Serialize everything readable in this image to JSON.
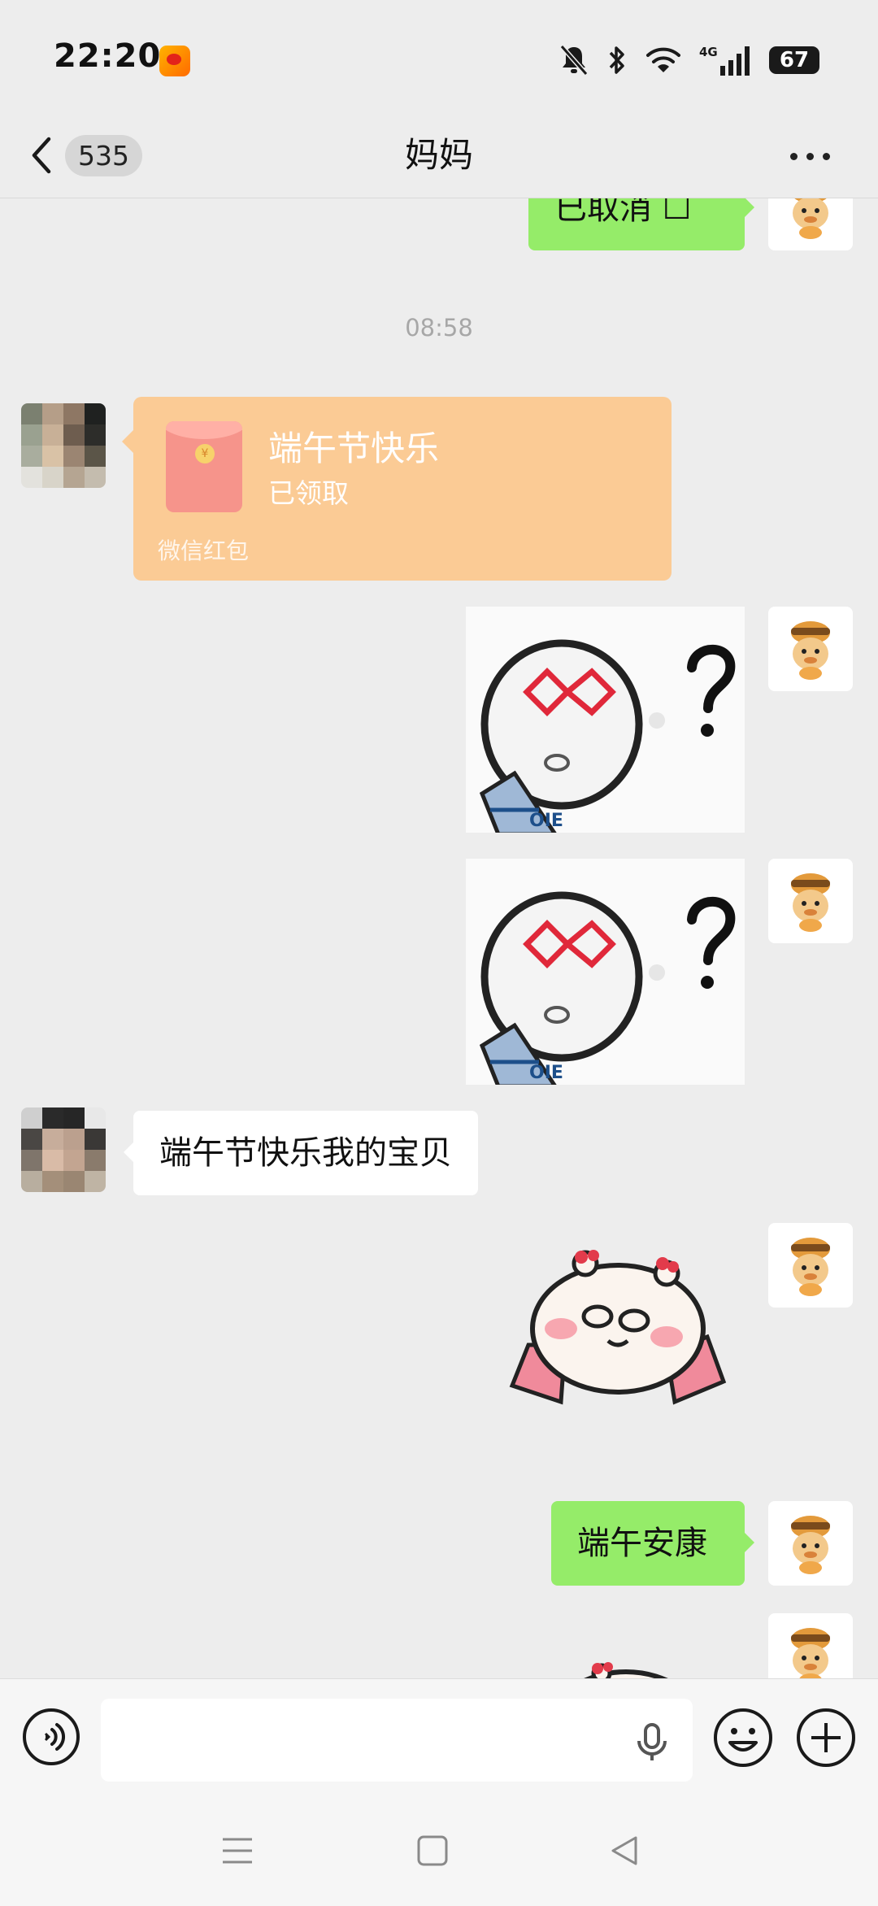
{
  "status_bar": {
    "time": "22:20",
    "app_notification_icon": "weibo-icon",
    "icons": [
      "mute-icon",
      "bluetooth-icon",
      "wifi-icon",
      "signal-4g-icon"
    ],
    "network_label": "4G",
    "battery": "67"
  },
  "header": {
    "unread_count": "535",
    "title": "妈妈",
    "back_icon": "chevron-left-icon",
    "more_icon": "more-icon"
  },
  "messages": [
    {
      "sender": "self",
      "type": "text",
      "text": "已取消 ☐"
    },
    {
      "type": "timestamp",
      "text": "08:58"
    },
    {
      "sender": "mom",
      "type": "red_packet",
      "title": "端午节快乐",
      "status": "已领取",
      "footer": "微信红包"
    },
    {
      "sender": "self",
      "type": "sticker",
      "sticker": "confused-face-sticker"
    },
    {
      "sender": "self",
      "type": "sticker",
      "sticker": "confused-face-sticker"
    },
    {
      "sender": "mom",
      "type": "text",
      "text": "端午节快乐我的宝贝"
    },
    {
      "sender": "self",
      "type": "sticker",
      "sticker": "shopping-bear-sticker"
    },
    {
      "sender": "self",
      "type": "text",
      "text": "端午安康"
    },
    {
      "sender": "self",
      "type": "sticker",
      "sticker": "shopping-bear-sticker"
    }
  ],
  "input_bar": {
    "text_value": "",
    "icons": [
      "voice-icon",
      "microphone-icon",
      "emoji-icon",
      "plus-icon"
    ]
  },
  "colors": {
    "background": "#ededed",
    "self_bubble": "#95ec69",
    "other_bubble": "#ffffff",
    "red_packet": "#fbcb95"
  }
}
